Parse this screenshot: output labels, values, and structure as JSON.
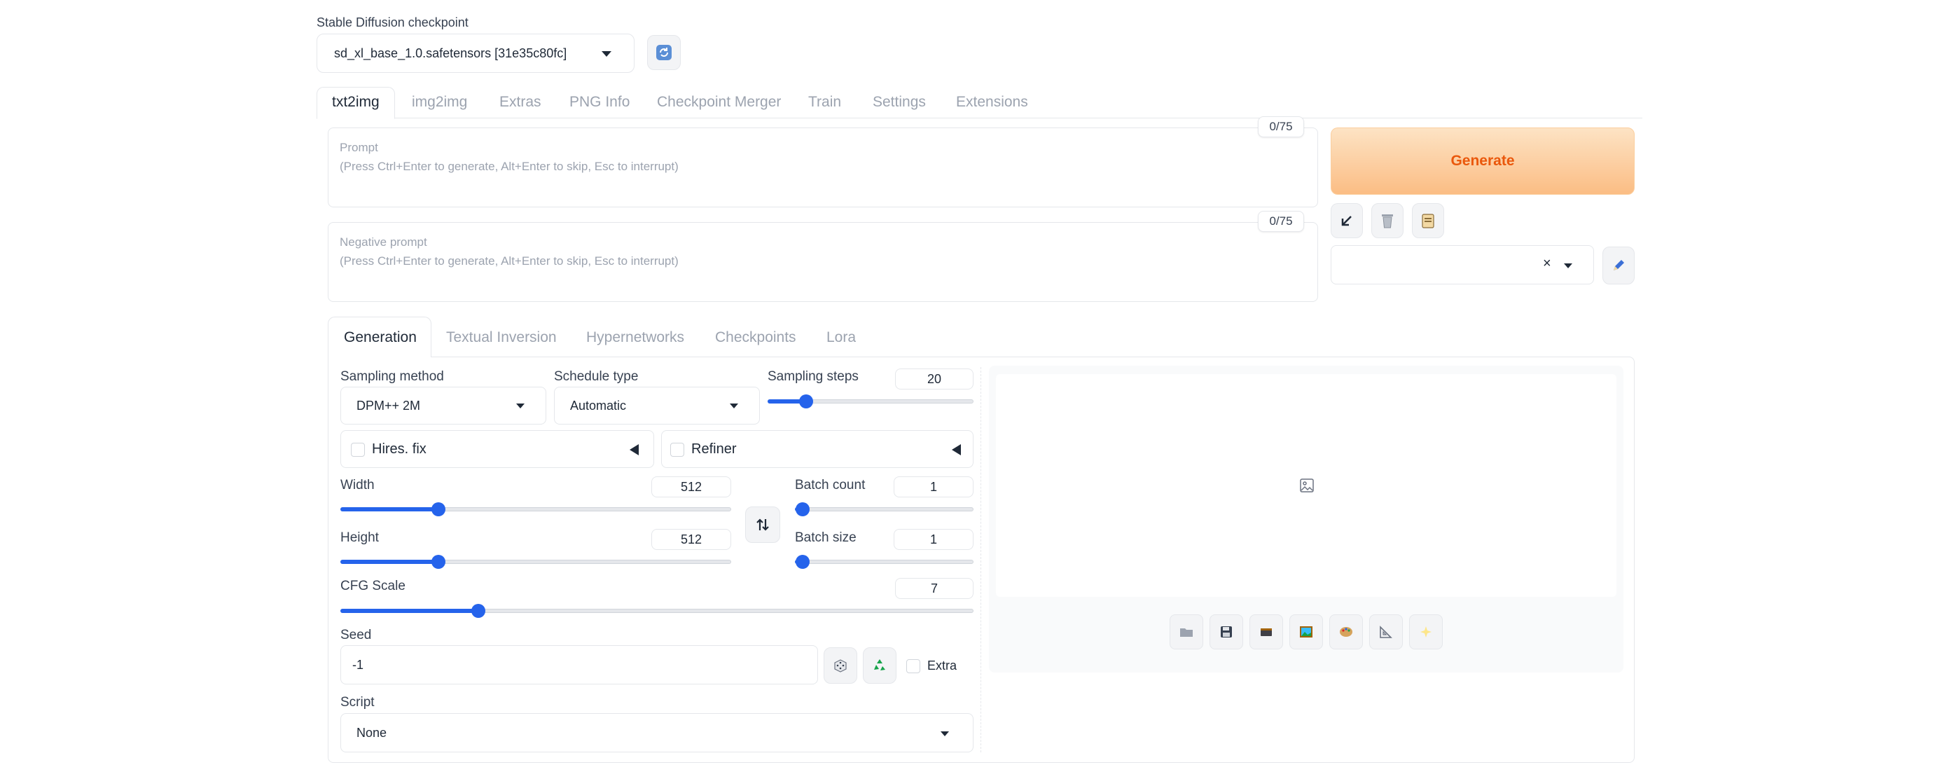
{
  "checkpoint": {
    "label": "Stable Diffusion checkpoint",
    "value": "sd_xl_base_1.0.safetensors [31e35c80fc]"
  },
  "main_tabs": [
    "txt2img",
    "img2img",
    "Extras",
    "PNG Info",
    "Checkpoint Merger",
    "Train",
    "Settings",
    "Extensions"
  ],
  "prompt": {
    "label": "Prompt",
    "placeholder": "(Press Ctrl+Enter to generate, Alt+Enter to skip, Esc to interrupt)",
    "counter": "0/75"
  },
  "negative_prompt": {
    "label": "Negative prompt",
    "placeholder": "(Press Ctrl+Enter to generate, Alt+Enter to skip, Esc to interrupt)",
    "counter": "0/75"
  },
  "generate_label": "Generate",
  "sub_tabs": [
    "Generation",
    "Textual Inversion",
    "Hypernetworks",
    "Checkpoints",
    "Lora"
  ],
  "sampling": {
    "method_label": "Sampling method",
    "method_value": "DPM++ 2M",
    "schedule_label": "Schedule type",
    "schedule_value": "Automatic",
    "steps_label": "Sampling steps",
    "steps_value": "20",
    "steps_fraction": 0.16
  },
  "hires_label": "Hires. fix",
  "refiner_label": "Refiner",
  "width": {
    "label": "Width",
    "value": "512",
    "fraction": 0.24
  },
  "height": {
    "label": "Height",
    "value": "512",
    "fraction": 0.24
  },
  "batch_count": {
    "label": "Batch count",
    "value": "1",
    "fraction": 0.0
  },
  "batch_size": {
    "label": "Batch size",
    "value": "1",
    "fraction": 0.0
  },
  "cfg": {
    "label": "CFG Scale",
    "value": "7",
    "fraction": 0.21
  },
  "seed": {
    "label": "Seed",
    "value": "-1",
    "extra_label": "Extra"
  },
  "script": {
    "label": "Script",
    "value": "None"
  },
  "colors": {
    "accent": "#2563eb",
    "generate_text": "#ea580c"
  },
  "icons": {
    "refresh": "refresh-icon",
    "paste": "arrow-down-left-icon",
    "trash": "trash-icon",
    "styles": "clipboard-icon",
    "edit": "pencil-icon",
    "swap": "swap-icon",
    "dice": "dice-icon",
    "recycle": "recycle-icon",
    "image_placeholder": "image-icon"
  }
}
